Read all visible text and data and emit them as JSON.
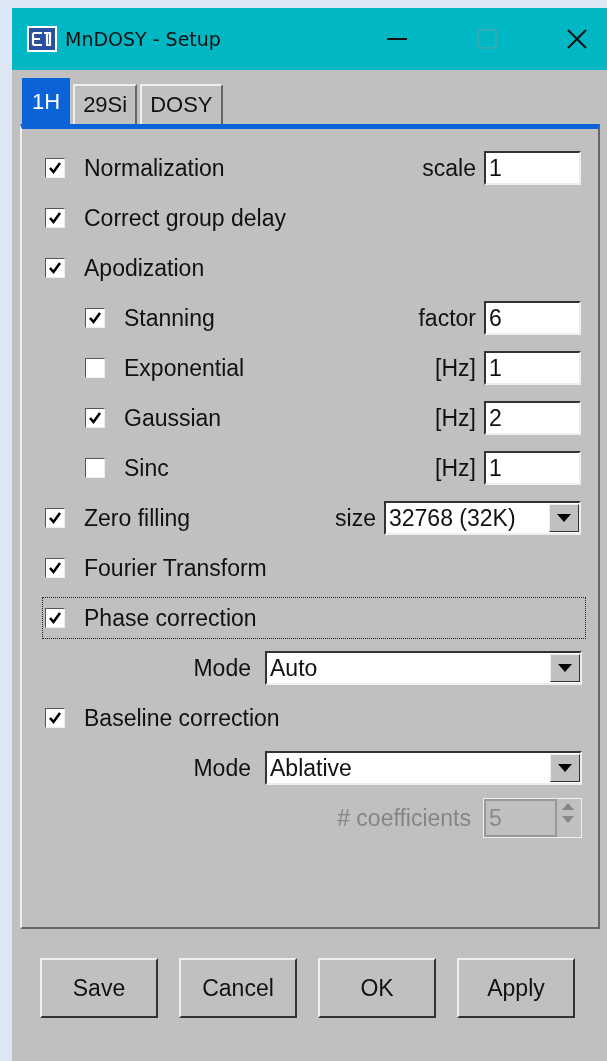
{
  "window": {
    "title": "MnDOSY - Setup",
    "controls": [
      {
        "kind": "minimize",
        "disabled": false
      },
      {
        "kind": "maximize",
        "disabled": true
      },
      {
        "kind": "close",
        "disabled": false
      }
    ]
  },
  "tabs": [
    {
      "label": "1H",
      "selected": true
    },
    {
      "label": "29Si",
      "selected": false
    },
    {
      "label": "DOSY",
      "selected": false
    }
  ],
  "options": [
    {
      "kind": "check",
      "label": "Normalization",
      "checked": true,
      "focused": false,
      "param": {
        "kind": "field",
        "label": "scale",
        "value": "1"
      }
    },
    {
      "kind": "check",
      "label": "Correct group delay",
      "checked": true,
      "focused": false
    },
    {
      "kind": "check",
      "label": "Apodization",
      "checked": true,
      "focused": false,
      "children": [
        {
          "kind": "check",
          "label": "Stanning",
          "checked": true,
          "focused": false,
          "param": {
            "kind": "field",
            "label": "factor",
            "value": "6"
          }
        },
        {
          "kind": "check",
          "label": "Exponential",
          "checked": false,
          "focused": false,
          "param": {
            "kind": "field",
            "label": "[Hz]",
            "value": "1"
          }
        },
        {
          "kind": "check",
          "label": "Gaussian",
          "checked": true,
          "focused": false,
          "param": {
            "kind": "field",
            "label": "[Hz]",
            "value": "2"
          }
        },
        {
          "kind": "check",
          "label": "Sinc",
          "checked": false,
          "focused": false,
          "param": {
            "kind": "field",
            "label": "[Hz]",
            "value": "1"
          }
        }
      ]
    },
    {
      "kind": "check",
      "label": "Zero filling",
      "checked": true,
      "focused": false,
      "param": {
        "kind": "select",
        "label": "size",
        "value": "32768 (32K)"
      }
    },
    {
      "kind": "check",
      "label": "Fourier Transform",
      "checked": true,
      "focused": false
    },
    {
      "kind": "check",
      "label": "Phase correction",
      "checked": true,
      "focused": true
    },
    {
      "kind": "select",
      "label": "Mode",
      "value": "Auto"
    },
    {
      "kind": "check",
      "label": "Baseline correction",
      "checked": true,
      "focused": false
    },
    {
      "kind": "select",
      "label": "Mode",
      "value": "Ablative"
    },
    {
      "kind": "spinner",
      "label": "# coefficients",
      "value": "5",
      "disabled": true
    }
  ],
  "buttons": [
    "Save",
    "Cancel",
    "OK",
    "Apply"
  ]
}
